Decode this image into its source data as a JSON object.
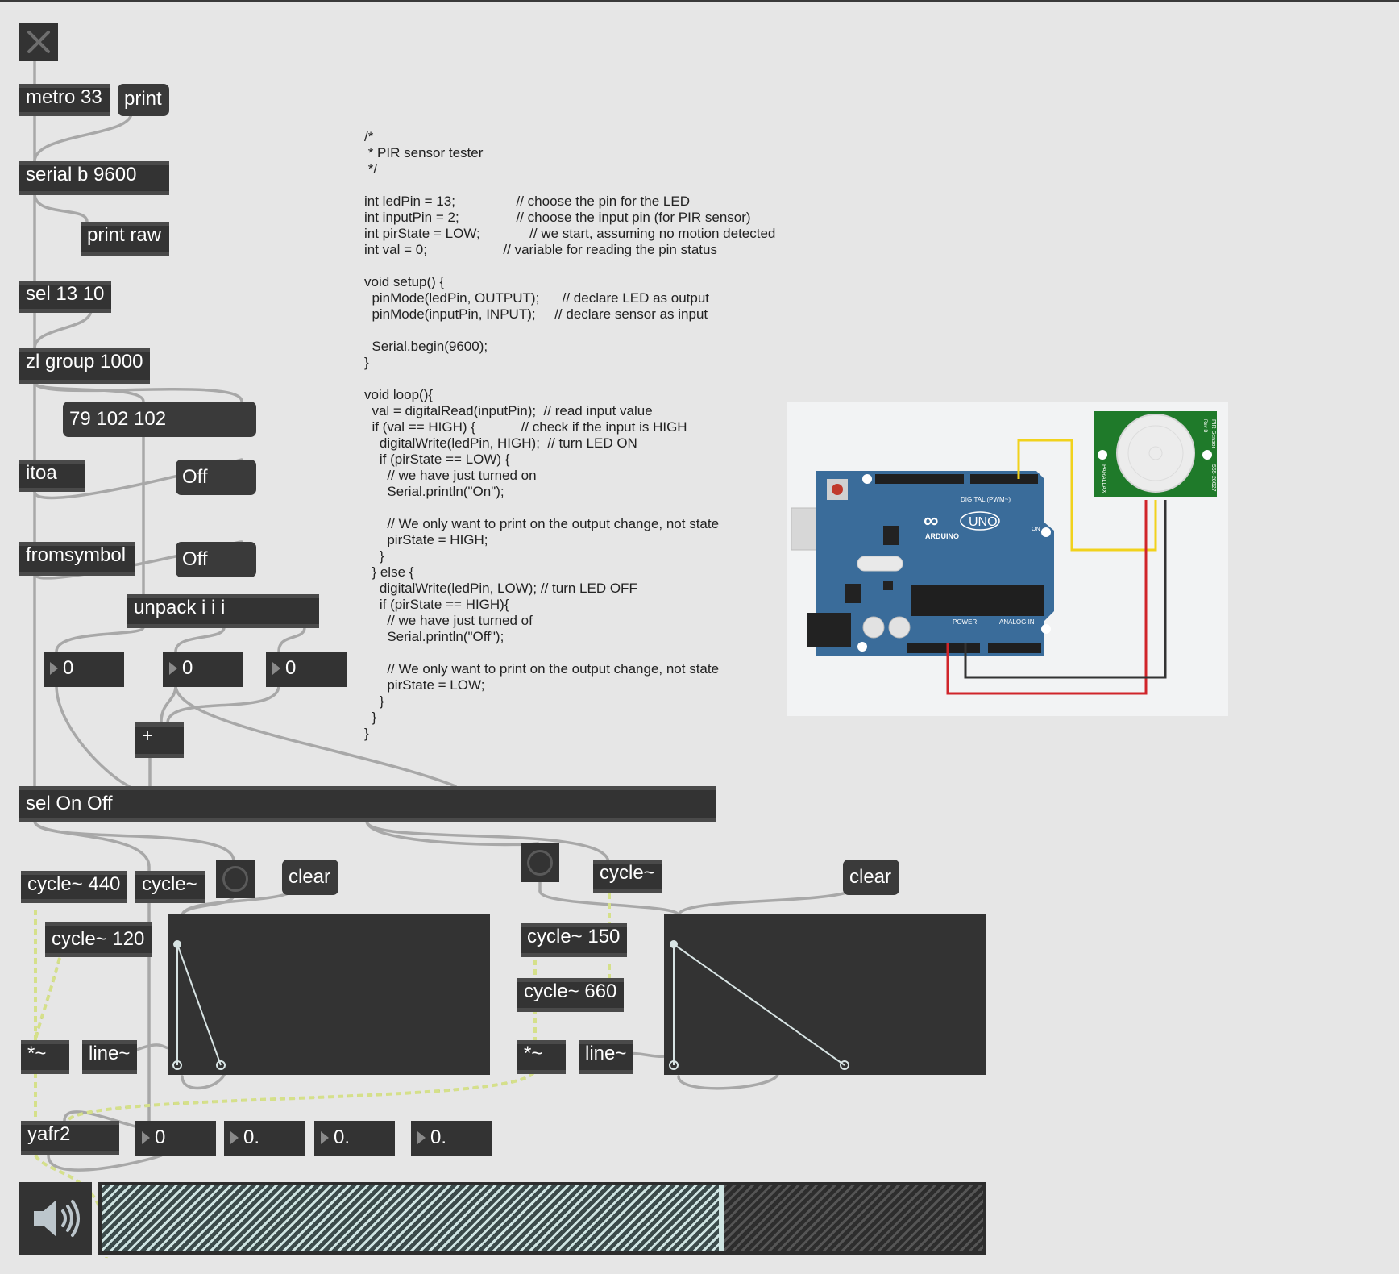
{
  "objects": {
    "metro": "metro 33",
    "print_msg": "print",
    "serial": "serial b 9600",
    "print_raw": "print raw",
    "sel_13_10": "sel 13 10",
    "zl_group": "zl group 1000",
    "itoa": "itoa",
    "fromsymbol": "fromsymbol",
    "unpack": "unpack i i i",
    "plus": "+",
    "sel_on_off": "sel On Off",
    "cycle_440": "cycle~ 440",
    "cycle_a": "cycle~",
    "cycle_120": "cycle~ 120",
    "mul_a": "*~",
    "line_a": "line~",
    "cycle_b": "cycle~",
    "cycle_150": "cycle~ 150",
    "cycle_660": "cycle~ 660",
    "mul_b": "*~",
    "line_b": "line~",
    "yafr2": "yafr2"
  },
  "messages": {
    "list_display": "79 102 102",
    "off_1": "Off",
    "off_2": "Off",
    "clear_a": "clear",
    "clear_b": "clear"
  },
  "number_boxes": {
    "unpack_1": "0",
    "unpack_2": "0",
    "unpack_3": "0",
    "yafr_1": "0",
    "yafr_2": "0.",
    "yafr_3": "0.",
    "yafr_4": "0."
  },
  "code_lines": [
    "/*",
    " * PIR sensor tester",
    " */",
    "",
    "int ledPin = 13;                // choose the pin for the LED",
    "int inputPin = 2;               // choose the input pin (for PIR sensor)",
    "int pirState = LOW;             // we start, assuming no motion detected",
    "int val = 0;                    // variable for reading the pin status",
    "",
    "void setup() {",
    "  pinMode(ledPin, OUTPUT);      // declare LED as output",
    "  pinMode(inputPin, INPUT);     // declare sensor as input",
    "",
    "  Serial.begin(9600);",
    "}",
    "",
    "void loop(){",
    "  val = digitalRead(inputPin);  // read input value",
    "  if (val == HIGH) {            // check if the input is HIGH",
    "    digitalWrite(ledPin, HIGH);  // turn LED ON",
    "    if (pirState == LOW) {",
    "      // we have just turned on",
    "      Serial.println(\"On\");",
    "",
    "      // We only want to print on the output change, not state",
    "      pirState = HIGH;",
    "    }",
    "  } else {",
    "    digitalWrite(ledPin, LOW); // turn LED OFF",
    "    if (pirState == HIGH){",
    "      // we have just turned of",
    "      Serial.println(\"Off\");",
    "",
    "      // We only want to print on the output change, not state",
    "      pirState = LOW;",
    "    }",
    "  }",
    "}"
  ],
  "diagram": {
    "arduino_brand": "ARDUINO",
    "arduino_model": "UNO",
    "digital_label": "DIGITAL (PWM~)",
    "power_label": "POWER",
    "analog_label": "ANALOG IN",
    "on_label": "ON",
    "pir_label": "PIR Sensor",
    "pir_rev": "Rev B",
    "pir_part": "555-28027",
    "pir_brand": "PARALLAX"
  },
  "meter": {
    "level": 0.7
  },
  "icons": {
    "toggle": "close-x-icon",
    "dac": "speaker-icon",
    "bang": "bang-button-icon"
  },
  "colors": {
    "canvas": "#e6e6e6",
    "object": "#333333",
    "patch_cord": "#a8a8a8",
    "signal_cord": "#d5e08a"
  }
}
